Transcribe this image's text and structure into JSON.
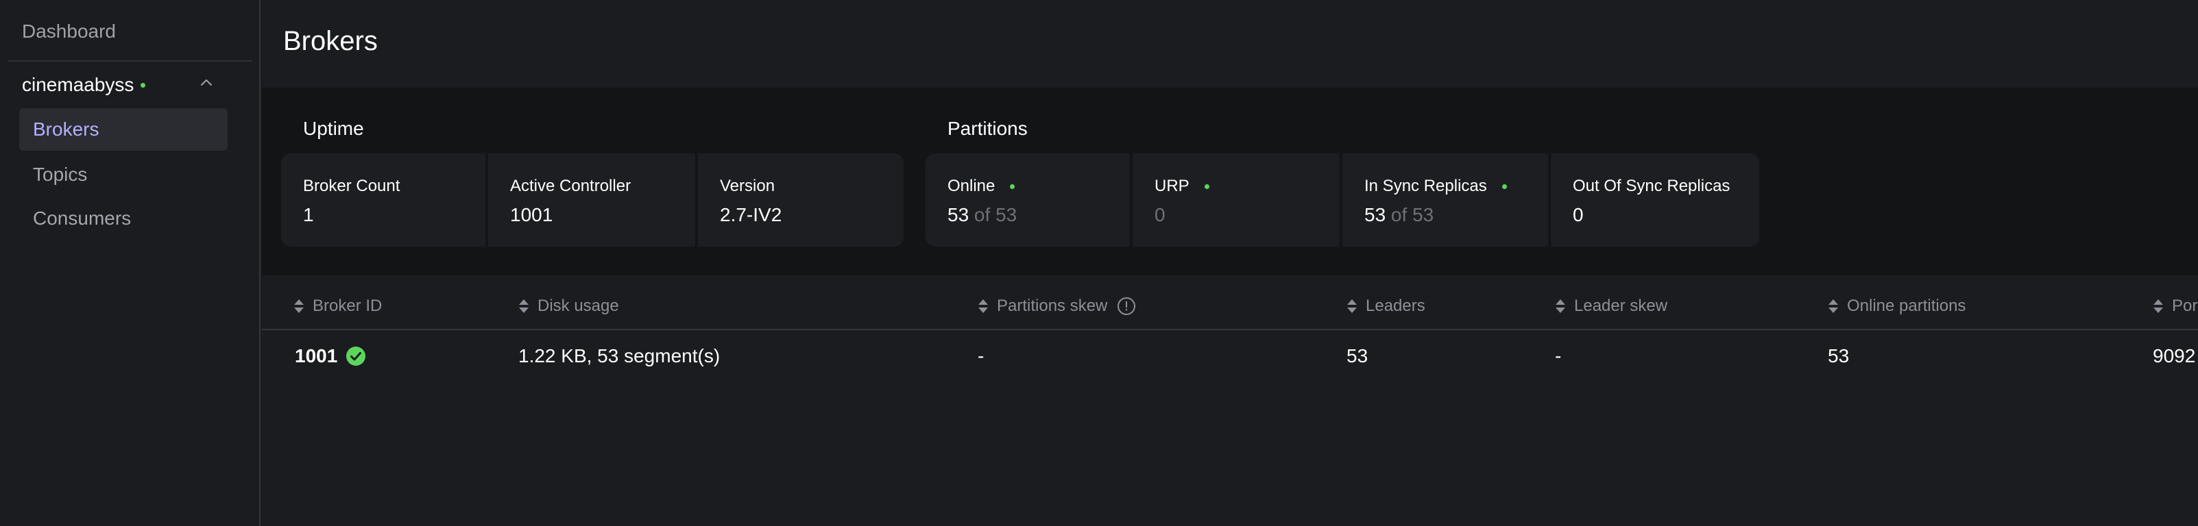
{
  "sidebar": {
    "dashboard": "Dashboard",
    "cluster_name": "cinemaabyss",
    "items": [
      {
        "label": "Brokers",
        "active": true
      },
      {
        "label": "Topics",
        "active": false
      },
      {
        "label": "Consumers",
        "active": false
      }
    ]
  },
  "page": {
    "title": "Brokers"
  },
  "uptime": {
    "title": "Uptime",
    "broker_count_label": "Broker Count",
    "broker_count_value": "1",
    "active_controller_label": "Active Controller",
    "active_controller_value": "1001",
    "version_label": "Version",
    "version_value": "2.7-IV2"
  },
  "partitions": {
    "title": "Partitions",
    "online_label": "Online",
    "online_value": "53",
    "online_of": " of 53",
    "urp_label": "URP",
    "urp_value": "0",
    "in_sync_label": "In Sync Replicas",
    "in_sync_value": "53",
    "in_sync_of": " of 53",
    "out_of_sync_label": "Out Of Sync Replicas",
    "out_of_sync_value": "0"
  },
  "table": {
    "headers": {
      "broker_id": "Broker ID",
      "disk_usage": "Disk usage",
      "partitions_skew": "Partitions skew",
      "leaders": "Leaders",
      "leader_skew": "Leader skew",
      "online_partitions": "Online partitions",
      "port": "Port"
    },
    "rows": [
      {
        "broker_id": "1001",
        "disk_usage": "1.22 KB, 53 segment(s)",
        "partitions_skew": "-",
        "leaders": "53",
        "leader_skew": "-",
        "online_partitions": "53",
        "port": "9092"
      }
    ]
  },
  "colors": {
    "accent": "#b4b0ff",
    "status_ok": "#5cd65c",
    "background": "#1b1c1f",
    "band": "#131416",
    "card": "#1d1e22"
  }
}
